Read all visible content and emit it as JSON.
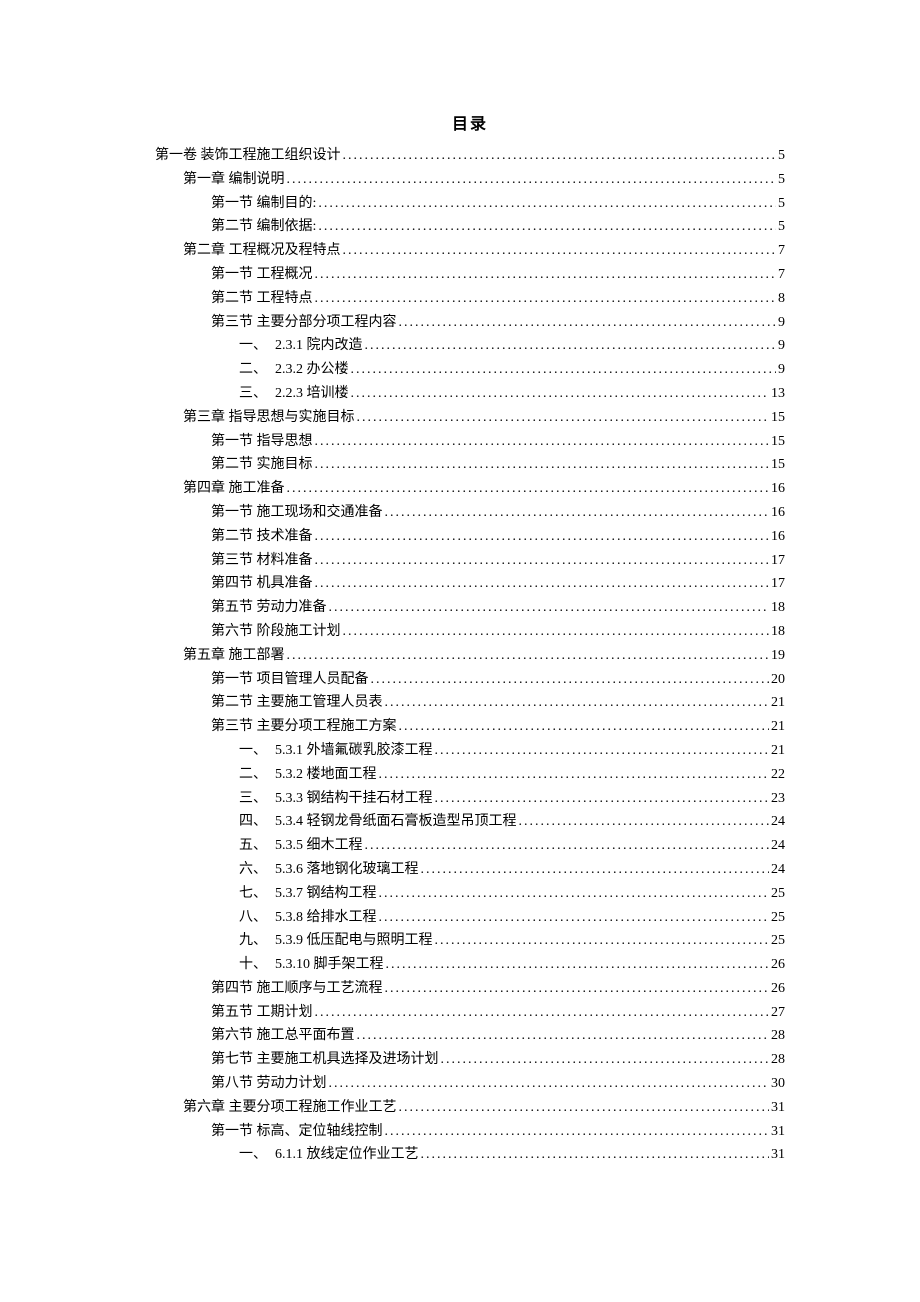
{
  "title": "目录",
  "entries": [
    {
      "indent": 0,
      "label": "第一卷 装饰工程施工组织设计",
      "page": "5"
    },
    {
      "indent": 1,
      "label": "第一章 编制说明",
      "page": "5"
    },
    {
      "indent": 2,
      "label": "第一节 编制目的:",
      "page": "5"
    },
    {
      "indent": 2,
      "label": "第二节 编制依据:",
      "page": "5"
    },
    {
      "indent": 1,
      "label": "第二章 工程概况及程特点",
      "page": "7"
    },
    {
      "indent": 2,
      "label": "第一节 工程概况",
      "page": "7"
    },
    {
      "indent": 2,
      "label": "第二节 工程特点",
      "page": "8"
    },
    {
      "indent": 2,
      "label": "第三节 主要分部分项工程内容",
      "page": "9"
    },
    {
      "indent": 3,
      "prefix": "一、",
      "label": "2.3.1 院内改造",
      "page": "9"
    },
    {
      "indent": 3,
      "prefix": "二、",
      "label": "2.3.2 办公楼",
      "page": "9"
    },
    {
      "indent": 3,
      "prefix": "三、",
      "label": "2.2.3 培训楼",
      "page": "13"
    },
    {
      "indent": 1,
      "label": "第三章 指导思想与实施目标",
      "page": "15"
    },
    {
      "indent": 2,
      "label": "第一节 指导思想",
      "page": "15"
    },
    {
      "indent": 2,
      "label": "第二节 实施目标",
      "page": "15"
    },
    {
      "indent": 1,
      "label": "第四章 施工准备",
      "page": "16"
    },
    {
      "indent": 2,
      "label": "第一节 施工现场和交通准备",
      "page": "16"
    },
    {
      "indent": 2,
      "label": "第二节 技术准备",
      "page": "16"
    },
    {
      "indent": 2,
      "label": "第三节 材料准备",
      "page": "17"
    },
    {
      "indent": 2,
      "label": "第四节 机具准备",
      "page": "17"
    },
    {
      "indent": 2,
      "label": "第五节 劳动力准备",
      "page": "18"
    },
    {
      "indent": 2,
      "label": "第六节 阶段施工计划",
      "page": "18"
    },
    {
      "indent": 1,
      "label": "第五章 施工部署",
      "page": "19"
    },
    {
      "indent": 2,
      "label": "第一节 项目管理人员配备",
      "page": "20"
    },
    {
      "indent": 2,
      "label": "第二节 主要施工管理人员表",
      "page": "21"
    },
    {
      "indent": 2,
      "label": "第三节 主要分项工程施工方案",
      "page": "21"
    },
    {
      "indent": 3,
      "prefix": "一、",
      "label": "5.3.1 外墙氟碳乳胶漆工程",
      "page": "21"
    },
    {
      "indent": 3,
      "prefix": "二、",
      "label": "5.3.2 楼地面工程",
      "page": "22"
    },
    {
      "indent": 3,
      "prefix": "三、",
      "label": "5.3.3 钢结构干挂石材工程",
      "page": "23"
    },
    {
      "indent": 3,
      "prefix": "四、",
      "label": "5.3.4 轻钢龙骨纸面石膏板造型吊顶工程",
      "page": "24"
    },
    {
      "indent": 3,
      "prefix": "五、",
      "label": "5.3.5 细木工程",
      "page": "24"
    },
    {
      "indent": 3,
      "prefix": "六、",
      "label": "5.3.6 落地钢化玻璃工程",
      "page": "24"
    },
    {
      "indent": 3,
      "prefix": "七、",
      "label": "5.3.7 钢结构工程",
      "page": "25"
    },
    {
      "indent": 3,
      "prefix": "八、",
      "label": "5.3.8 给排水工程",
      "page": "25"
    },
    {
      "indent": 3,
      "prefix": "九、",
      "label": "5.3.9 低压配电与照明工程",
      "page": "25"
    },
    {
      "indent": 3,
      "prefix": "十、",
      "label": "5.3.10 脚手架工程",
      "page": "26"
    },
    {
      "indent": 2,
      "label": "第四节 施工顺序与工艺流程",
      "page": "26"
    },
    {
      "indent": 2,
      "label": "第五节 工期计划",
      "page": "27"
    },
    {
      "indent": 2,
      "label": "第六节 施工总平面布置",
      "page": "28"
    },
    {
      "indent": 2,
      "label": "第七节 主要施工机具选择及进场计划",
      "page": "28"
    },
    {
      "indent": 2,
      "label": "第八节 劳动力计划",
      "page": "30"
    },
    {
      "indent": 1,
      "label": "第六章 主要分项工程施工作业工艺",
      "page": "31"
    },
    {
      "indent": 2,
      "label": "第一节 标高、定位轴线控制",
      "page": "31"
    },
    {
      "indent": 3,
      "prefix": "一、",
      "label": "6.1.1 放线定位作业工艺",
      "page": "31"
    }
  ]
}
